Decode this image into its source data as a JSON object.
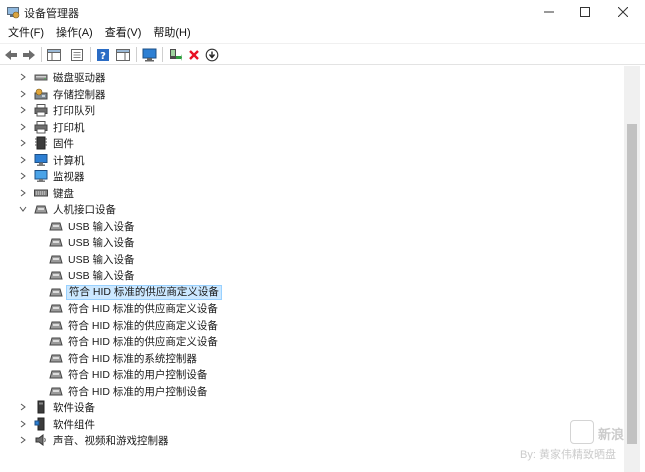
{
  "window": {
    "title": "设备管理器"
  },
  "menu": [
    "文件(F)",
    "操作(A)",
    "查看(V)",
    "帮助(H)"
  ],
  "toolbar": [
    "back-icon",
    "forward-icon",
    "show-hide-console-tree-icon",
    "properties-icon",
    "help-icon",
    "action-pane-icon",
    "monitor-icon",
    "update-driver-icon",
    "uninstall-icon",
    "download-icon"
  ],
  "tree": [
    {
      "label": "磁盘驱动器",
      "icon": "disk-drive-icon",
      "level": 0,
      "expanded": false
    },
    {
      "label": "存储控制器",
      "icon": "storage-controller-icon",
      "level": 0,
      "expanded": false
    },
    {
      "label": "打印队列",
      "icon": "printer-icon",
      "level": 0,
      "expanded": false
    },
    {
      "label": "打印机",
      "icon": "printer-icon",
      "level": 0,
      "expanded": false
    },
    {
      "label": "固件",
      "icon": "firmware-icon",
      "level": 0,
      "expanded": false
    },
    {
      "label": "计算机",
      "icon": "computer-icon",
      "level": 0,
      "expanded": false
    },
    {
      "label": "监视器",
      "icon": "monitor-icon",
      "level": 0,
      "expanded": false
    },
    {
      "label": "键盘",
      "icon": "keyboard-icon",
      "level": 0,
      "expanded": false
    },
    {
      "label": "人机接口设备",
      "icon": "hid-icon",
      "level": 0,
      "expanded": true
    },
    {
      "label": "USB 输入设备",
      "icon": "hid-icon",
      "level": 1
    },
    {
      "label": "USB 输入设备",
      "icon": "hid-icon",
      "level": 1
    },
    {
      "label": "USB 输入设备",
      "icon": "hid-icon",
      "level": 1
    },
    {
      "label": "USB 输入设备",
      "icon": "hid-icon",
      "level": 1
    },
    {
      "label": "符合 HID 标准的供应商定义设备",
      "icon": "hid-icon",
      "level": 1,
      "selected": true
    },
    {
      "label": "符合 HID 标准的供应商定义设备",
      "icon": "hid-icon",
      "level": 1
    },
    {
      "label": "符合 HID 标准的供应商定义设备",
      "icon": "hid-icon",
      "level": 1
    },
    {
      "label": "符合 HID 标准的供应商定义设备",
      "icon": "hid-icon",
      "level": 1
    },
    {
      "label": "符合 HID 标准的系统控制器",
      "icon": "hid-icon",
      "level": 1
    },
    {
      "label": "符合 HID 标准的用户控制设备",
      "icon": "hid-icon",
      "level": 1
    },
    {
      "label": "符合 HID 标准的用户控制设备",
      "icon": "hid-icon",
      "level": 1
    },
    {
      "label": "软件设备",
      "icon": "software-device-icon",
      "level": 0,
      "expanded": false
    },
    {
      "label": "软件组件",
      "icon": "software-component-icon",
      "level": 0,
      "expanded": false
    },
    {
      "label": "声音、视频和游戏控制器",
      "icon": "audio-icon",
      "level": 0,
      "expanded": false
    }
  ],
  "watermark": {
    "text": "By: 黄家伟精致晒盘",
    "brand": "新浪"
  },
  "colors": {
    "selection": "#cce8ff",
    "selection_border": "#99d1ff",
    "uninstall_red": "#e81123"
  }
}
